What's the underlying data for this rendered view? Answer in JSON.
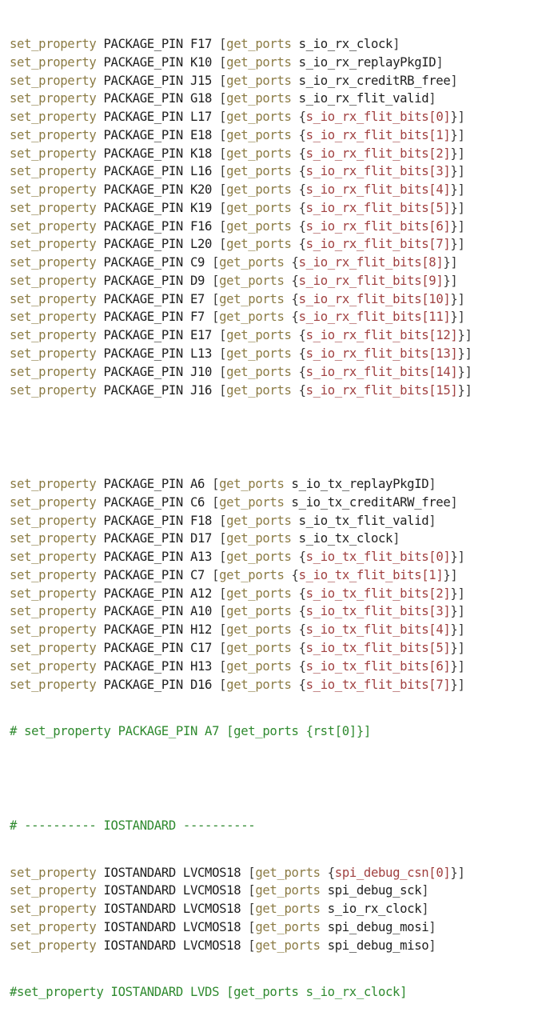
{
  "rx_lines": [
    {
      "pin": "F17",
      "port": "s_io_rx_clock",
      "idx": null
    },
    {
      "pin": "K10",
      "port": "s_io_rx_replayPkgID",
      "idx": null
    },
    {
      "pin": "J15",
      "port": "s_io_rx_creditRB_free",
      "idx": null
    },
    {
      "pin": "G18",
      "port": "s_io_rx_flit_valid",
      "idx": null
    },
    {
      "pin": "L17",
      "port": "s_io_rx_flit_bits",
      "idx": "0"
    },
    {
      "pin": "E18",
      "port": "s_io_rx_flit_bits",
      "idx": "1"
    },
    {
      "pin": "K18",
      "port": "s_io_rx_flit_bits",
      "idx": "2"
    },
    {
      "pin": "L16",
      "port": "s_io_rx_flit_bits",
      "idx": "3"
    },
    {
      "pin": "K20",
      "port": "s_io_rx_flit_bits",
      "idx": "4"
    },
    {
      "pin": "K19",
      "port": "s_io_rx_flit_bits",
      "idx": "5"
    },
    {
      "pin": "F16",
      "port": "s_io_rx_flit_bits",
      "idx": "6"
    },
    {
      "pin": "L20",
      "port": "s_io_rx_flit_bits",
      "idx": "7"
    },
    {
      "pin": "C9",
      "port": "s_io_rx_flit_bits",
      "idx": "8"
    },
    {
      "pin": "D9",
      "port": "s_io_rx_flit_bits",
      "idx": "9"
    },
    {
      "pin": "E7",
      "port": "s_io_rx_flit_bits",
      "idx": "10"
    },
    {
      "pin": "F7",
      "port": "s_io_rx_flit_bits",
      "idx": "11"
    },
    {
      "pin": "E17",
      "port": "s_io_rx_flit_bits",
      "idx": "12"
    },
    {
      "pin": "L13",
      "port": "s_io_rx_flit_bits",
      "idx": "13"
    },
    {
      "pin": "J10",
      "port": "s_io_rx_flit_bits",
      "idx": "14"
    },
    {
      "pin": "J16",
      "port": "s_io_rx_flit_bits",
      "idx": "15"
    }
  ],
  "tx_lines": [
    {
      "pin": "A6",
      "port": "s_io_tx_replayPkgID",
      "idx": null
    },
    {
      "pin": "C6",
      "port": "s_io_tx_creditARW_free",
      "idx": null
    },
    {
      "pin": "F18",
      "port": "s_io_tx_flit_valid",
      "idx": null
    },
    {
      "pin": "D17",
      "port": "s_io_tx_clock",
      "idx": null
    },
    {
      "pin": "A13",
      "port": "s_io_tx_flit_bits",
      "idx": "0"
    },
    {
      "pin": "C7",
      "port": "s_io_tx_flit_bits",
      "idx": "1"
    },
    {
      "pin": "A12",
      "port": "s_io_tx_flit_bits",
      "idx": "2"
    },
    {
      "pin": "A10",
      "port": "s_io_tx_flit_bits",
      "idx": "3"
    },
    {
      "pin": "H12",
      "port": "s_io_tx_flit_bits",
      "idx": "4"
    },
    {
      "pin": "C17",
      "port": "s_io_tx_flit_bits",
      "idx": "5"
    },
    {
      "pin": "H13",
      "port": "s_io_tx_flit_bits",
      "idx": "6"
    },
    {
      "pin": "D16",
      "port": "s_io_tx_flit_bits",
      "idx": "7"
    }
  ],
  "keywords": {
    "set_property": "set_property",
    "package_pin": "PACKAGE_PIN",
    "get_ports": "get_ports",
    "iostandard": "IOSTANDARD"
  },
  "commented_rst_line": "# set_property PACKAGE_PIN A7 [get_ports {rst[0]}]",
  "iostandard_header": "# ---------- IOSTANDARD ----------",
  "iostandard_lines": [
    {
      "std": "LVCMOS18",
      "port": "spi_debug_csn",
      "idx": "0"
    },
    {
      "std": "LVCMOS18",
      "port": "spi_debug_sck",
      "idx": null
    },
    {
      "std": "LVCMOS18",
      "port": "s_io_rx_clock",
      "idx": null
    },
    {
      "std": "LVCMOS18",
      "port": "spi_debug_mosi",
      "idx": null
    },
    {
      "std": "LVCMOS18",
      "port": "spi_debug_miso",
      "idx": null
    }
  ],
  "commented_lvds_line": "#set_property IOSTANDARD LVDS [get_ports s_io_rx_clock]",
  "colors": {
    "keyword": "#8b7b44",
    "text": "#1f1f1f",
    "index": "#a04040",
    "comment": "#2f8a2f"
  }
}
